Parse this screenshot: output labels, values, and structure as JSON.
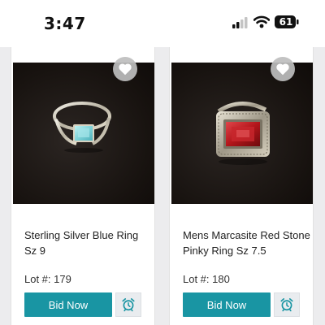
{
  "status_bar": {
    "time": "3:47",
    "battery": "61"
  },
  "lots": [
    {
      "title": "Sterling Silver Blue Ring Sz 9",
      "lot_label": "Lot #: 179",
      "bid_label": "Bid Now",
      "stone_color": "#7fd3d8"
    },
    {
      "title": "Mens Marcasite Red Stone Pinky Ring Sz 7.5",
      "lot_label": "Lot #: 180",
      "bid_label": "Bid Now",
      "stone_color": "#b3161b"
    }
  ],
  "colors": {
    "accent": "#1995a3"
  }
}
